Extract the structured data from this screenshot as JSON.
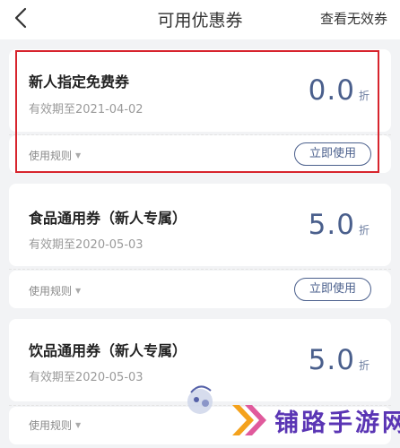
{
  "header": {
    "title": "可用优惠券",
    "right_link": "查看无效券"
  },
  "coupons": [
    {
      "name": "新人指定免费券",
      "validity": "有效期至2021-04-02",
      "discount_value": "0.0",
      "discount_unit": "折",
      "rules_label": "使用规则",
      "action_label": "立即使用",
      "highlighted": true
    },
    {
      "name": "食品通用券（新人专属）",
      "validity": "有效期至2020-05-03",
      "discount_value": "5.0",
      "discount_unit": "折",
      "rules_label": "使用规则",
      "action_label": "立即使用",
      "highlighted": false
    },
    {
      "name": "饮品通用券（新人专属）",
      "validity": "有效期至2020-05-03",
      "discount_value": "5.0",
      "discount_unit": "折",
      "rules_label": "使用规则",
      "highlighted": false
    }
  ],
  "watermark": {
    "text": "铺路手游网"
  },
  "colors": {
    "accent": "#4a5f8c",
    "highlight_border": "#d7242d",
    "background": "#f2f3f5",
    "watermark": "#5a35b4"
  },
  "icons": {
    "back": "chevron-left-icon",
    "rules_caret": "caret-down-icon"
  }
}
